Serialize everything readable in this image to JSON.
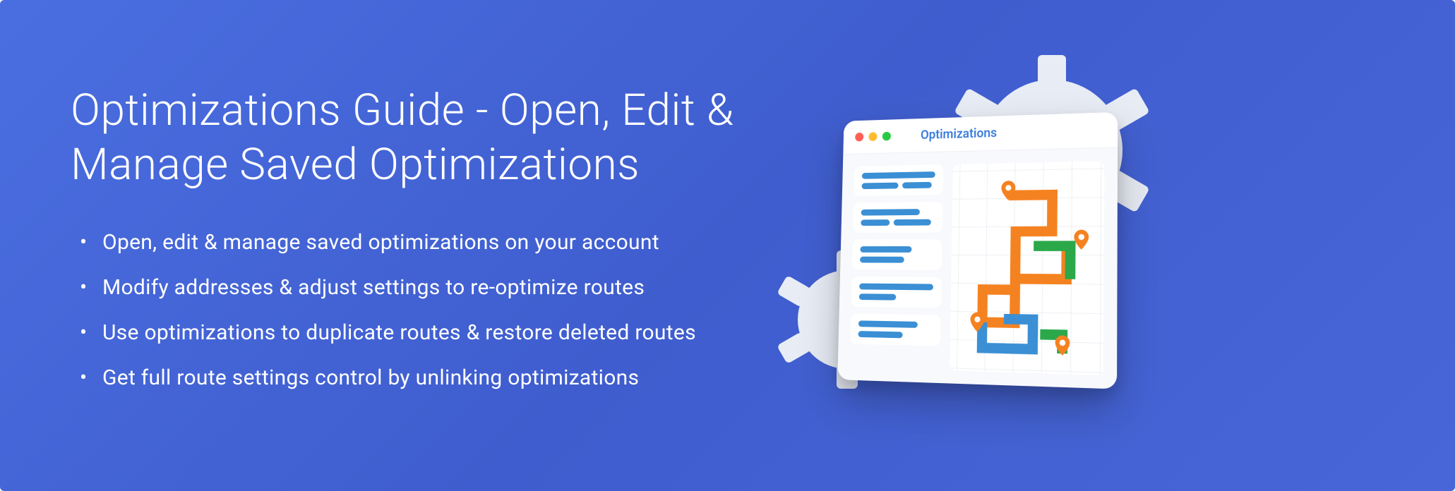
{
  "heading": "Optimizations Guide - Open, Edit & Manage Saved Optimizations",
  "bullets": [
    "Open, edit & manage saved optimizations on your account",
    "Modify addresses & adjust settings to re-optimize routes",
    "Use optimizations to duplicate routes & restore deleted routes",
    "Get full route settings control by unlinking optimizations"
  ],
  "illustration": {
    "window_title": "Optimizations"
  }
}
